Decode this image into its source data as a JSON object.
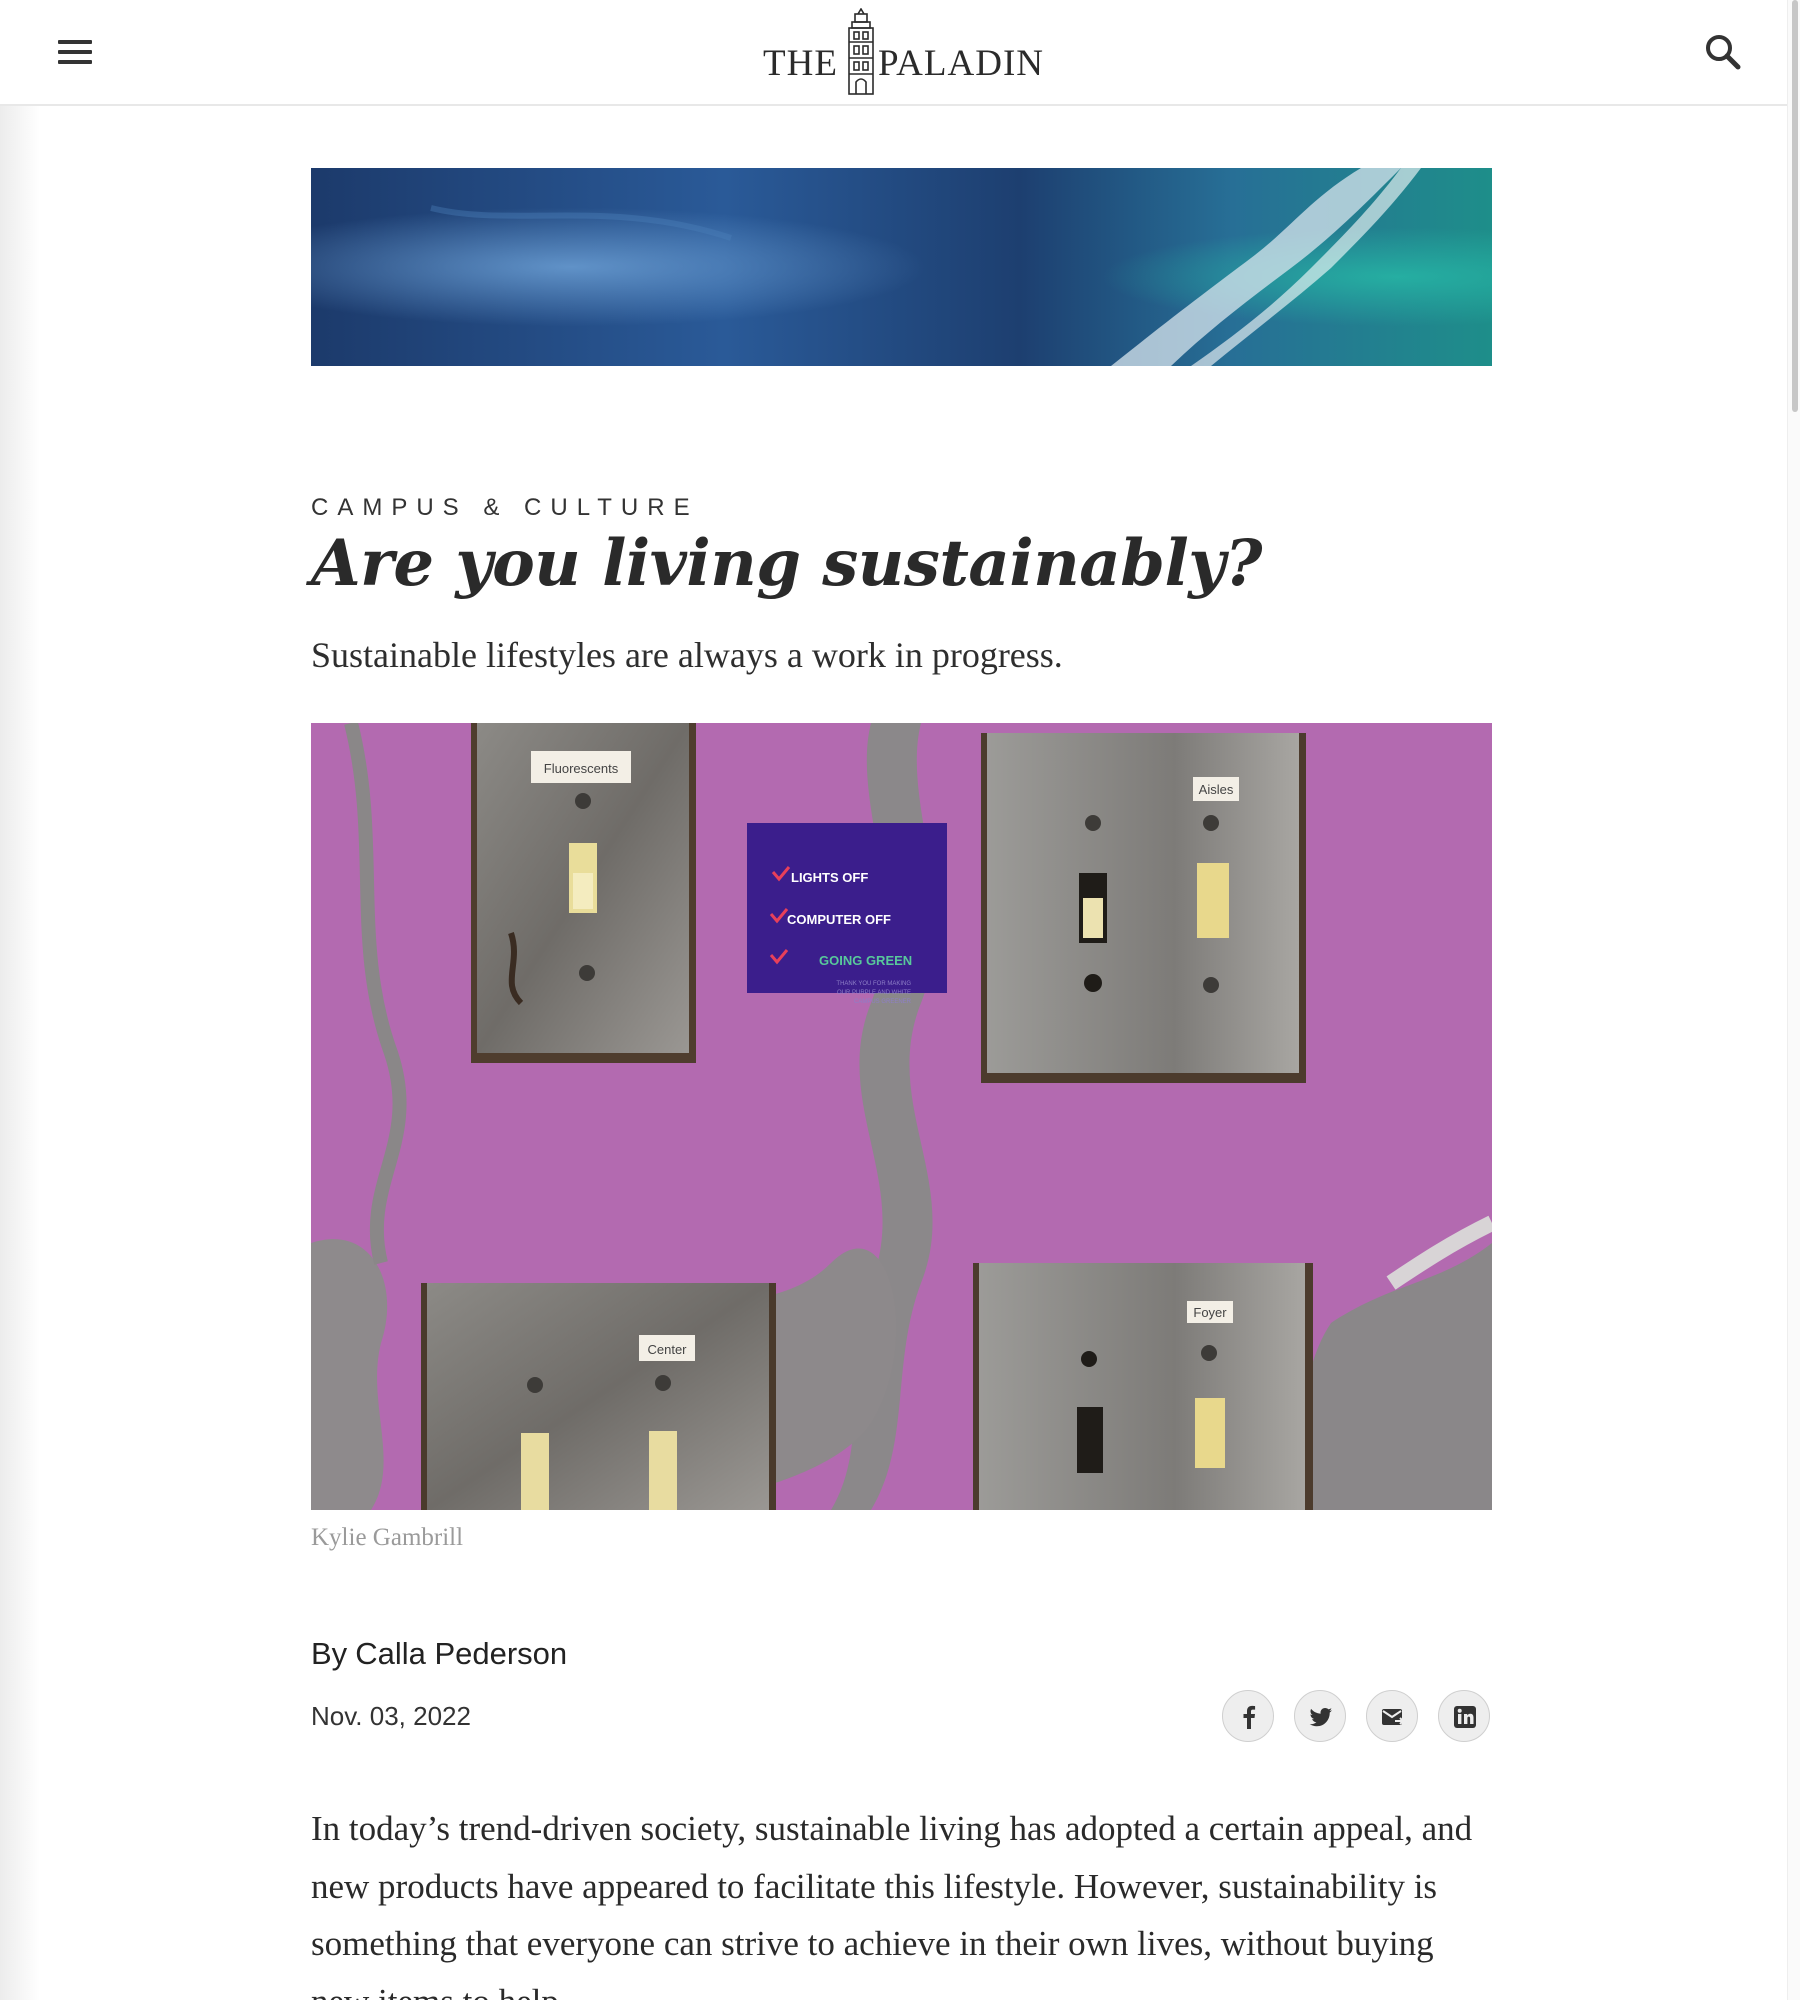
{
  "header": {
    "logo_the": "THE",
    "logo_paladin": "PALADIN",
    "menu_icon": "hamburger-menu-icon",
    "search_icon": "search-icon"
  },
  "article": {
    "kicker": "CAMPUS & CULTURE",
    "headline": "Are you living sustainably?",
    "dek": "Sustainable lifestyles are always a work in progress.",
    "photo_caption": "Kylie Gambrill",
    "byline_prefix": "By",
    "byline_name": "Calla Pederson",
    "date": "Nov. 03, 2022",
    "body_paragraph": "In today’s trend-driven society, sustainable living has adopted a certain appeal, and new products have appeared to facilitate this lifestyle. However, sustainability is something that everyone can strive to achieve in their own lives, without buying new items to help."
  },
  "photo_labels": {
    "switch_fluorescents": "Fluorescents",
    "switch_aisles": "Aisles",
    "switch_center": "Center",
    "switch_foyer": "Foyer",
    "sign_line_1": "LIGHTS OFF",
    "sign_line_2": "COMPUTER OFF",
    "sign_line_3": "GOING GREEN",
    "sign_small_1": "THANK YOU FOR MAKING",
    "sign_small_2": "OUR PURPLE AND WHITE",
    "sign_small_3": "CAMPUS GREENER"
  },
  "share": {
    "icons": [
      "facebook-icon",
      "twitter-icon",
      "email-icon",
      "linkedin-icon"
    ]
  },
  "colors": {
    "text": "#2a2a2a",
    "caption": "#9a9a9a",
    "wall_purple": "#b36ab0",
    "sign_blue": "#3b1e8c"
  }
}
